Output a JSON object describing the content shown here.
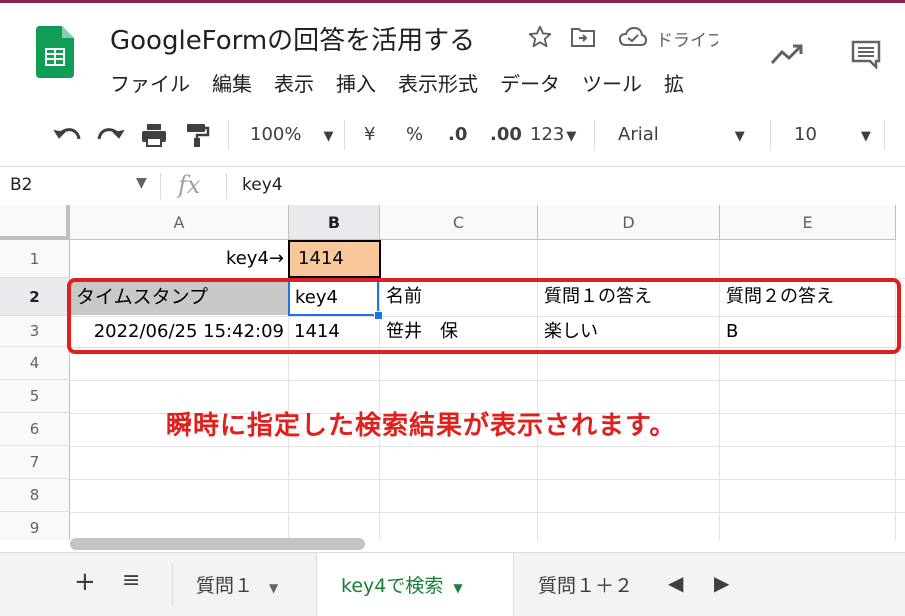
{
  "app": {
    "title": "GoogleFormの回答を活用する",
    "drive_label": "ドライブ",
    "menu": [
      "ファイル",
      "編集",
      "表示",
      "挿入",
      "表示形式",
      "データ",
      "ツール",
      "拡"
    ]
  },
  "toolbar": {
    "zoom": "100%",
    "currency": "¥",
    "percent": "%",
    "decimal_decrease": ".0",
    "decimal_increase": ".00",
    "number_format": "123",
    "font": "Arial",
    "font_size": "10"
  },
  "formula_bar": {
    "cell_ref": "B2",
    "fx": "fx",
    "value": "key4"
  },
  "columns": [
    "A",
    "B",
    "C",
    "D",
    "E"
  ],
  "rows": [
    "1",
    "2",
    "3",
    "4",
    "5",
    "6",
    "7",
    "8",
    "9"
  ],
  "cells": {
    "A1": "key4→",
    "B1": "1414",
    "A2": "タイムスタンプ",
    "B2": "key4",
    "C2": "名前",
    "D2": "質問１の答え",
    "E2": "質問２の答え",
    "A3": "2022/06/25 15:42:09",
    "B3": "1414",
    "C3": "笹井　保",
    "D3": "楽しい",
    "E3": "B"
  },
  "annotation": "瞬時に指定した検索結果が表示されます。",
  "sheet_tabs": [
    {
      "label": "質問１",
      "active": false
    },
    {
      "label": "key4で検索",
      "active": true
    },
    {
      "label": "質問１＋２",
      "active": false
    }
  ],
  "colors": {
    "accent_green": "#188038",
    "highlight_orange": "#f9c89a",
    "selection_blue": "#1a73e8",
    "annotation_red": "#e0201c",
    "header_gray": "#c8c8c8"
  }
}
